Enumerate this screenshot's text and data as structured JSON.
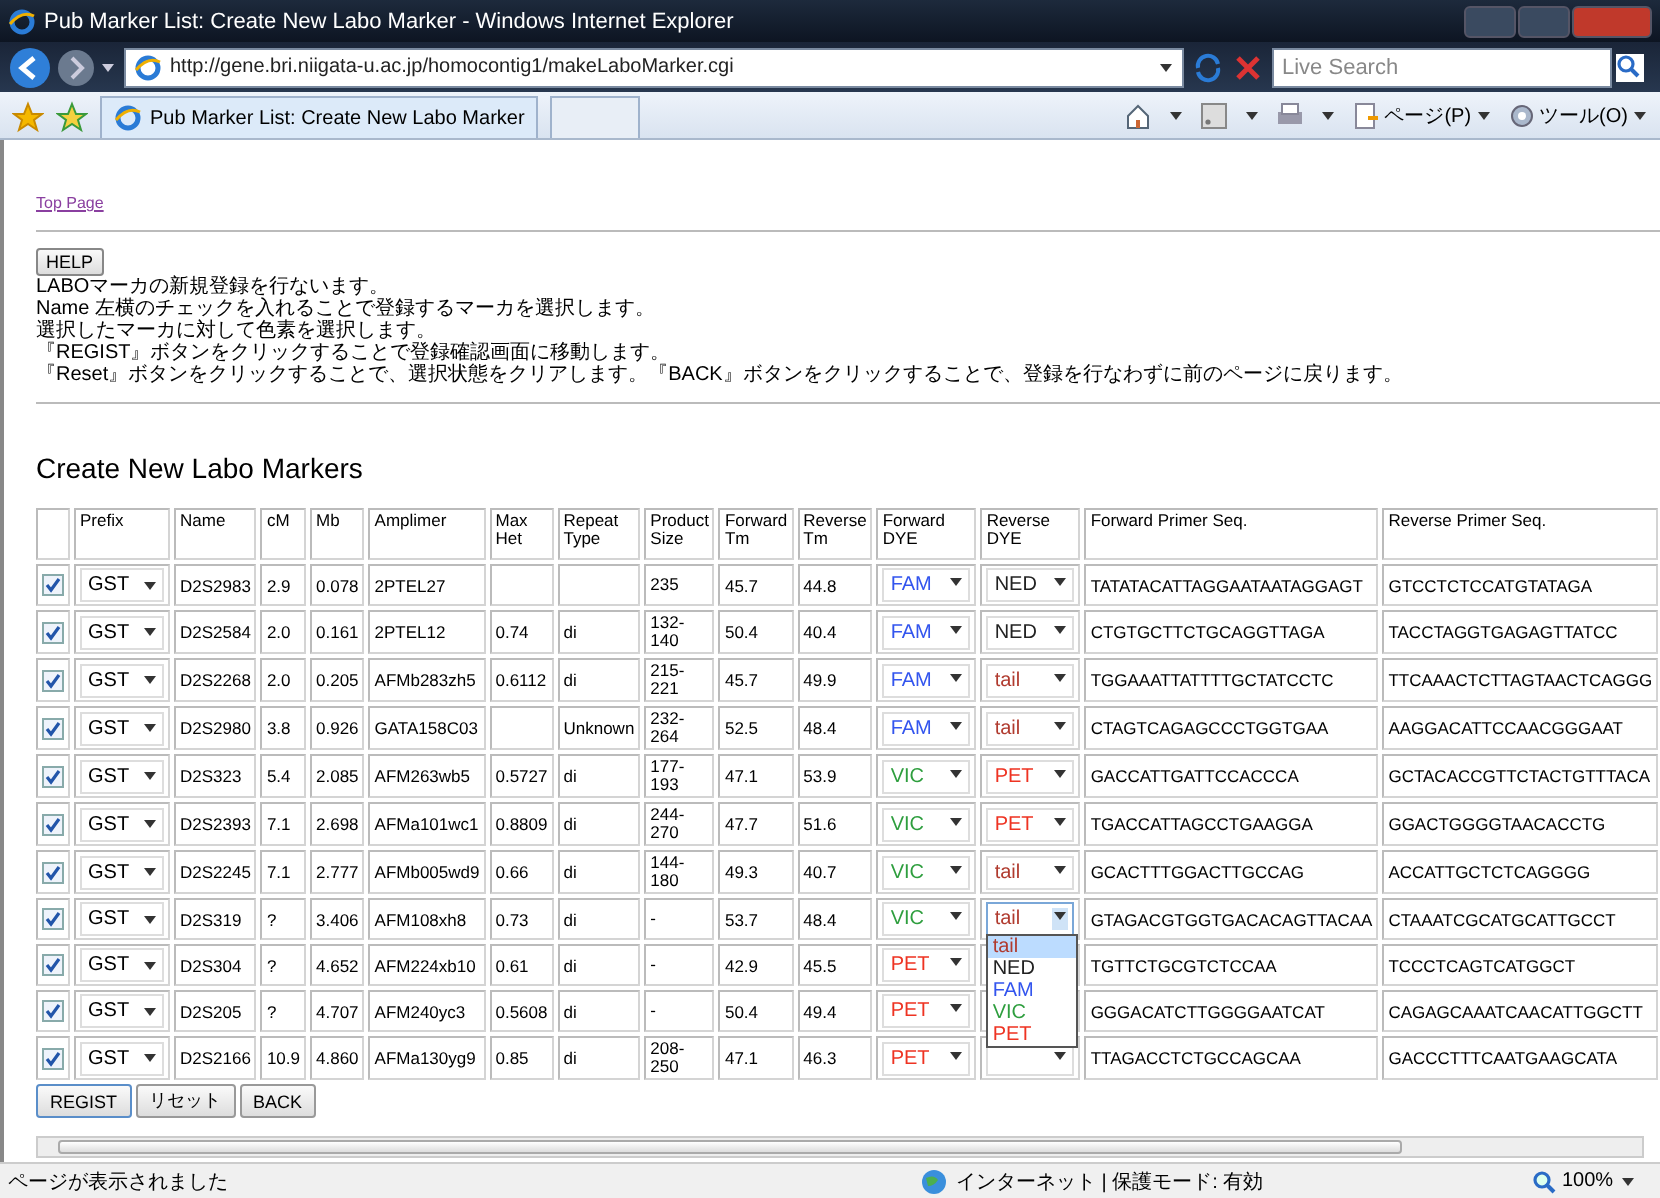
{
  "window": {
    "title": "Pub Marker List: Create New Labo Marker - Windows Internet Explorer"
  },
  "address_bar": {
    "url": "http://gene.bri.niigata-u.ac.jp/homocontig1/makeLaboMarker.cgi"
  },
  "search": {
    "placeholder": "Live Search"
  },
  "tabs": [
    {
      "label": "Pub Marker List: Create New Labo Marker",
      "selected": true
    }
  ],
  "command_bar": [
    {
      "label": "ページ(P)"
    },
    {
      "label": "ツール(O)"
    }
  ],
  "page": {
    "top_link": "Top Page",
    "help_button": "HELP",
    "instructions": [
      "LABOマーカの新規登録を行ないます。",
      "Name 左横のチェックを入れることで登録するマーカを選択します。",
      "選択したマーカに対して色素を選択します。",
      "『REGIST』ボタンをクリックすることで登録確認画面に移動します。",
      "『Reset』ボタンをクリックすることで、選択状態をクリアします。『BACK』ボタンをクリックすることで、登録を行なわずに前のページに戻ります。"
    ],
    "heading": "Create New Labo Markers",
    "table": {
      "columns": [
        "Prefix",
        "Name",
        "cM",
        "Mb",
        "Amplimer",
        "Max Het",
        "Repeat Type",
        "Product Size",
        "Forward Tm",
        "Reverse Tm",
        "Forward DYE",
        "Reverse DYE",
        "Forward Primer Seq.",
        "Reverse Primer Seq."
      ],
      "rows": [
        {
          "checked": true,
          "prefix": "GST",
          "name": "D2S2983",
          "cm": "2.9",
          "mb": "0.078",
          "amplimer": "2PTEL27",
          "max_het": "",
          "repeat_type": "",
          "product_size": "235",
          "forward_tm": "45.7",
          "reverse_tm": "44.8",
          "forward_dye": {
            "label": "FAM",
            "color": "#3355ee"
          },
          "reverse_dye": {
            "label": "NED",
            "color": "#222222",
            "expanded": false
          },
          "forward_seq": "TATATACATTAGGAATAATAGGAGT",
          "reverse_seq": "GTCCTCTCCATGTATAGA"
        },
        {
          "checked": true,
          "prefix": "GST",
          "name": "D2S2584",
          "cm": "2.0",
          "mb": "0.161",
          "amplimer": "2PTEL12",
          "max_het": "0.74",
          "repeat_type": "di",
          "product_size": "132-140",
          "forward_tm": "50.4",
          "reverse_tm": "40.4",
          "forward_dye": {
            "label": "FAM",
            "color": "#3355ee"
          },
          "reverse_dye": {
            "label": "NED",
            "color": "#222222",
            "expanded": false
          },
          "forward_seq": "CTGTGCTTCTGCAGGTTAGA",
          "reverse_seq": "TACCTAGGTGAGAGTTATCC"
        },
        {
          "checked": true,
          "prefix": "GST",
          "name": "D2S2268",
          "cm": "2.0",
          "mb": "0.205",
          "amplimer": "AFMb283zh5",
          "max_het": "0.6112",
          "repeat_type": "di",
          "product_size": "215-221",
          "forward_tm": "45.7",
          "reverse_tm": "49.9",
          "forward_dye": {
            "label": "FAM",
            "color": "#3355ee"
          },
          "reverse_dye": {
            "label": "tail",
            "color": "#b03a2e",
            "expanded": false
          },
          "forward_seq": "TGGAAATTATTTTGCTATCCTC",
          "reverse_seq": "TTCAAACTCTTAGTAACTCAGGG"
        },
        {
          "checked": true,
          "prefix": "GST",
          "name": "D2S2980",
          "cm": "3.8",
          "mb": "0.926",
          "amplimer": "GATA158C03",
          "max_het": "",
          "repeat_type": "Unknown",
          "product_size": "232-264",
          "forward_tm": "52.5",
          "reverse_tm": "48.4",
          "forward_dye": {
            "label": "FAM",
            "color": "#3355ee"
          },
          "reverse_dye": {
            "label": "tail",
            "color": "#b03a2e",
            "expanded": false
          },
          "forward_seq": "CTAGTCAGAGCCCTGGTGAA",
          "reverse_seq": "AAGGACATTCCAACGGGAAT"
        },
        {
          "checked": true,
          "prefix": "GST",
          "name": "D2S323",
          "cm": "5.4",
          "mb": "2.085",
          "amplimer": "AFM263wb5",
          "max_het": "0.5727",
          "repeat_type": "di",
          "product_size": "177-193",
          "forward_tm": "47.1",
          "reverse_tm": "53.9",
          "forward_dye": {
            "label": "VIC",
            "color": "#2e9e3e"
          },
          "reverse_dye": {
            "label": "PET",
            "color": "#ee3322",
            "expanded": false
          },
          "forward_seq": "GACCATTGATTCCACCCA",
          "reverse_seq": "GCTACACCGTTCTACTGTTTACA"
        },
        {
          "checked": true,
          "prefix": "GST",
          "name": "D2S2393",
          "cm": "7.1",
          "mb": "2.698",
          "amplimer": "AFMa101wc1",
          "max_het": "0.8809",
          "repeat_type": "di",
          "product_size": "244-270",
          "forward_tm": "47.7",
          "reverse_tm": "51.6",
          "forward_dye": {
            "label": "VIC",
            "color": "#2e9e3e"
          },
          "reverse_dye": {
            "label": "PET",
            "color": "#ee3322",
            "expanded": false
          },
          "forward_seq": "TGACCATTAGCCTGAAGGA",
          "reverse_seq": "GGACTGGGGTAACACCTG"
        },
        {
          "checked": true,
          "prefix": "GST",
          "name": "D2S2245",
          "cm": "7.1",
          "mb": "2.777",
          "amplimer": "AFMb005wd9",
          "max_het": "0.66",
          "repeat_type": "di",
          "product_size": "144-180",
          "forward_tm": "49.3",
          "reverse_tm": "40.7",
          "forward_dye": {
            "label": "VIC",
            "color": "#2e9e3e"
          },
          "reverse_dye": {
            "label": "tail",
            "color": "#b03a2e",
            "expanded": false
          },
          "forward_seq": "GCACTTTGGACTTGCCAG",
          "reverse_seq": "ACCATTGCTCTCAGGGG"
        },
        {
          "checked": true,
          "prefix": "GST",
          "name": "D2S319",
          "cm": "?",
          "mb": "3.406",
          "amplimer": "AFM108xh8",
          "max_het": "0.73",
          "repeat_type": "di",
          "product_size": "-",
          "forward_tm": "53.7",
          "reverse_tm": "48.4",
          "forward_dye": {
            "label": "VIC",
            "color": "#2e9e3e"
          },
          "reverse_dye": {
            "label": "tail",
            "color": "#b03a2e",
            "expanded": true,
            "options": [
              {
                "label": "tail",
                "color": "#b03a2e",
                "selected": true
              },
              {
                "label": "NED",
                "color": "#222222",
                "selected": false
              },
              {
                "label": "FAM",
                "color": "#3355ee",
                "selected": false
              },
              {
                "label": "VIC",
                "color": "#2e9e3e",
                "selected": false
              },
              {
                "label": "PET",
                "color": "#ee3322",
                "selected": false
              }
            ]
          },
          "forward_seq": "GTAGACGTGGTGACACAGTTACAA",
          "reverse_seq": "CTAAATCGCATGCATTGCCT"
        },
        {
          "checked": true,
          "prefix": "GST",
          "name": "D2S304",
          "cm": "?",
          "mb": "4.652",
          "amplimer": "AFM224xb10",
          "max_het": "0.61",
          "repeat_type": "di",
          "product_size": "-",
          "forward_tm": "42.9",
          "reverse_tm": "45.5",
          "forward_dye": {
            "label": "PET",
            "color": "#ee3322"
          },
          "forward_seq": "TGTTCTGCGTCTCCAA",
          "reverse_seq": "TCCCTCAGTCATGGCT"
        },
        {
          "checked": true,
          "prefix": "GST",
          "name": "D2S205",
          "cm": "?",
          "mb": "4.707",
          "amplimer": "AFM240yc3",
          "max_het": "0.5608",
          "repeat_type": "di",
          "product_size": "-",
          "forward_tm": "50.4",
          "reverse_tm": "49.4",
          "forward_dye": {
            "label": "PET",
            "color": "#ee3322"
          },
          "forward_seq": "GGGACATCTTGGGGAATCAT",
          "reverse_seq": "CAGAGCAAATCAACATTGGCTT"
        },
        {
          "checked": true,
          "prefix": "GST",
          "name": "D2S2166",
          "cm": "10.9",
          "mb": "4.860",
          "amplimer": "AFMa130yg9",
          "max_het": "0.85",
          "repeat_type": "di",
          "product_size": "208-250",
          "forward_tm": "47.1",
          "reverse_tm": "46.3",
          "forward_dye": {
            "label": "PET",
            "color": "#ee3322"
          },
          "reverse_dye": {},
          "forward_seq": "TTAGACCTCTGCCAGCAA",
          "reverse_seq": "GACCCTTTCAATGAAGCATA"
        }
      ]
    },
    "buttons": [
      "REGIST",
      "リセット",
      "BACK"
    ]
  },
  "status_bar": {
    "message": "ページが表示されました",
    "zone": "インターネット | 保護モード: 有効",
    "zoom": "100%"
  }
}
